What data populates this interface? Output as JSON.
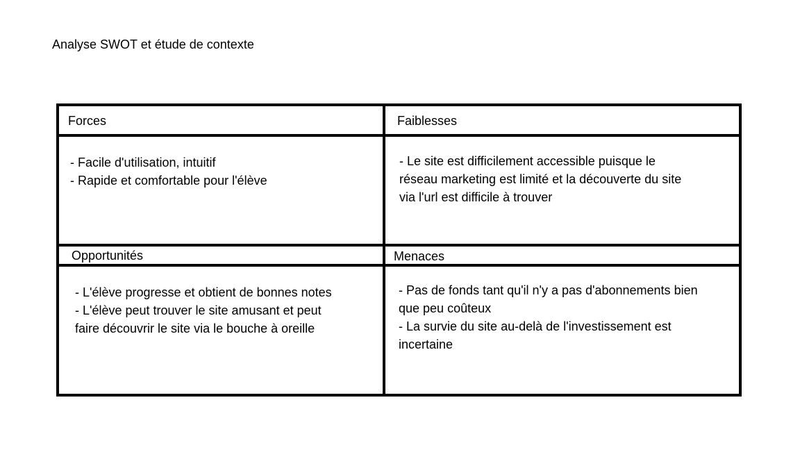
{
  "title": "Analyse SWOT et étude de contexte",
  "swot": {
    "strengths": {
      "label": "Forces",
      "lines": [
        "- Facile d'utilisation, intuitif",
        "- Rapide et comfortable pour l'élève"
      ]
    },
    "weaknesses": {
      "label": "Faiblesses",
      "lines": [
        "- Le site est difficilement accessible puisque le",
        "réseau marketing est limité et la découverte du site",
        "via l'url est difficile à trouver"
      ]
    },
    "opportunities": {
      "label": "Opportunités",
      "lines": [
        "- L'élève progresse et obtient de bonnes notes",
        "- L'élève peut trouver le site amusant et peut",
        "faire découvrir le site via le bouche à oreille"
      ]
    },
    "threats": {
      "label": "Menaces",
      "lines": [
        "- Pas de fonds tant qu'il n'y a pas d'abonnements bien",
        "que peu coûteux",
        "- La survie du site au-delà de l'investissement est",
        "incertaine"
      ]
    }
  }
}
